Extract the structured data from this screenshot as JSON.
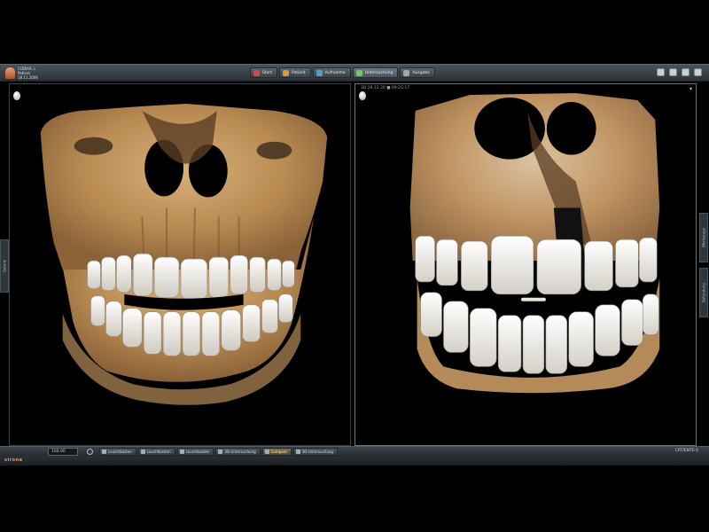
{
  "patient": {
    "line1": "CODIAX, L",
    "line2": "Patient",
    "line3": "18.11.2006"
  },
  "topnav": [
    {
      "label": "Start",
      "icon": "home-icon",
      "color": "#c94b4b"
    },
    {
      "label": "Patient",
      "icon": "patient-icon",
      "color": "#d49a3b"
    },
    {
      "label": "Aufnahme",
      "icon": "capture-icon",
      "color": "#4aa0c9"
    },
    {
      "label": "Untersuchung",
      "icon": "examine-icon",
      "color": "#7bc36a"
    },
    {
      "label": "Ausgabe",
      "icon": "output-icon",
      "color": "#9fa7af"
    }
  ],
  "right_panel": {
    "header": "3D 26.12.20 ■ 09:25:17"
  },
  "side_tabs": {
    "left": "Galerie",
    "right_top": "Werkzeuge",
    "right_bottom": "Befundung"
  },
  "bottombar": {
    "zoom": "100.00",
    "tasks": [
      {
        "label": "Leuchtkasten"
      },
      {
        "label": "Leuchtkasten"
      },
      {
        "label": "Leuchtkasten"
      },
      {
        "label": "3D-Untersuchung"
      },
      {
        "label": "Compare",
        "active": true
      },
      {
        "label": "3D-Untersuchung"
      }
    ],
    "counter": "CRT/ENTE 6"
  },
  "footer": {
    "brand": "sirona"
  },
  "colors": {
    "bone": "#c69a61",
    "tooth": "#f2efe8",
    "background": "#000000",
    "accent": "#e5a54a"
  }
}
